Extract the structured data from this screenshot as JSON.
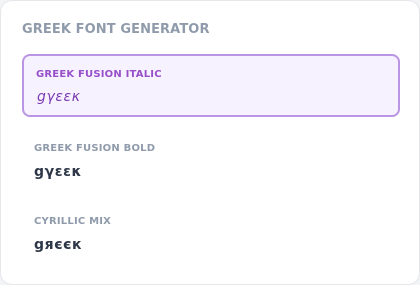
{
  "panel": {
    "title": "GREEK FONT GENERATOR",
    "options": [
      {
        "label": "GREEK FUSION ITALIC",
        "sample": "gγεεκ",
        "selected": true
      },
      {
        "label": "GREEK FUSION BOLD",
        "sample": "gγεεκ",
        "selected": false
      },
      {
        "label": "CYRILLIC MIX",
        "sample": "gяєєк",
        "selected": false
      }
    ]
  },
  "colors": {
    "accent": "#9750c9",
    "selected_border": "#b995e3",
    "selected_bg": "#f7f2ff",
    "muted_text": "#8f9bab",
    "sample_text": "#2d3748"
  }
}
